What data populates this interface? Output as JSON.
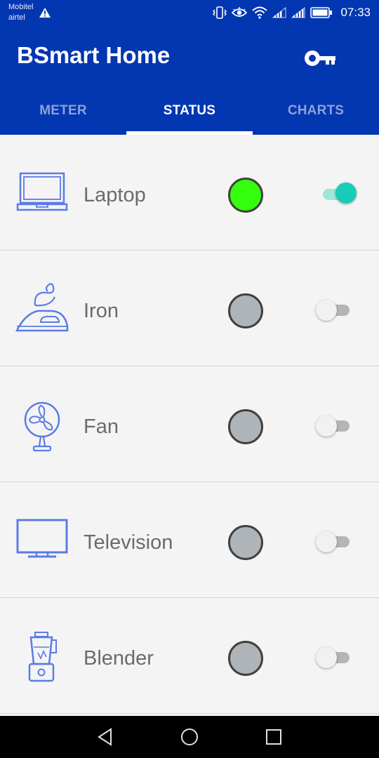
{
  "status_bar": {
    "carrier_1": "Mobitel",
    "carrier_2": "airtel",
    "time": "07:33"
  },
  "app_bar": {
    "title": "BSmart Home",
    "key_icon": "key-icon"
  },
  "tabs": [
    {
      "label": "METER",
      "active": false
    },
    {
      "label": "STATUS",
      "active": true
    },
    {
      "label": "CHARTS",
      "active": false
    }
  ],
  "devices": [
    {
      "label": "Laptop",
      "icon": "laptop-icon",
      "status_color": "#33ff0d",
      "on": true
    },
    {
      "label": "Iron",
      "icon": "iron-icon",
      "status_color": "#afb4b8",
      "on": false
    },
    {
      "label": "Fan",
      "icon": "fan-icon",
      "status_color": "#afb4b8",
      "on": false
    },
    {
      "label": "Television",
      "icon": "television-icon",
      "status_color": "#afb4b8",
      "on": false
    },
    {
      "label": "Blender",
      "icon": "blender-icon",
      "status_color": "#afb4b8",
      "on": false
    }
  ],
  "colors": {
    "primary": "#0336b1",
    "tab_inactive": "#8fa1d6",
    "icon_stroke": "#5b7be6",
    "switch_on": "#17cdb8"
  }
}
